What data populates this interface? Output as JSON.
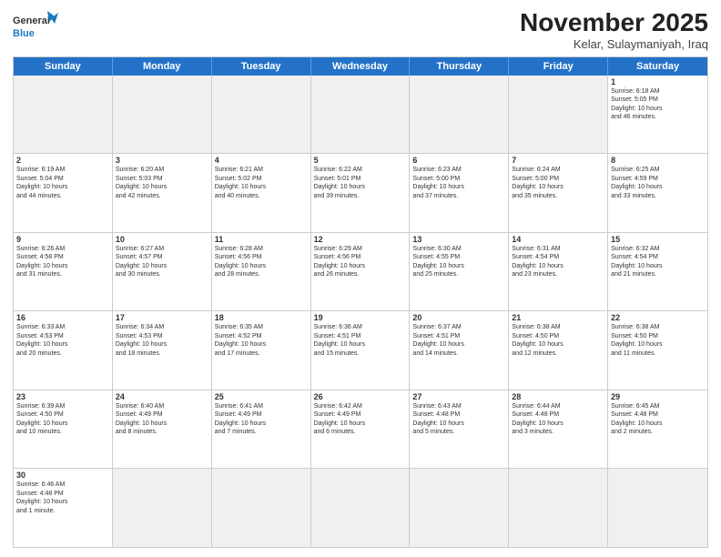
{
  "header": {
    "logo_general": "General",
    "logo_blue": "Blue",
    "month_title": "November 2025",
    "subtitle": "Kelar, Sulaymaniyah, Iraq"
  },
  "weekdays": [
    "Sunday",
    "Monday",
    "Tuesday",
    "Wednesday",
    "Thursday",
    "Friday",
    "Saturday"
  ],
  "weeks": [
    [
      {
        "day": "",
        "empty": true
      },
      {
        "day": "",
        "empty": true
      },
      {
        "day": "",
        "empty": true
      },
      {
        "day": "",
        "empty": true
      },
      {
        "day": "",
        "empty": true
      },
      {
        "day": "",
        "empty": true
      },
      {
        "day": "1",
        "info": "Sunrise: 6:18 AM\nSunset: 5:05 PM\nDaylight: 10 hours\nand 46 minutes."
      }
    ],
    [
      {
        "day": "2",
        "info": "Sunrise: 6:19 AM\nSunset: 5:04 PM\nDaylight: 10 hours\nand 44 minutes."
      },
      {
        "day": "3",
        "info": "Sunrise: 6:20 AM\nSunset: 5:03 PM\nDaylight: 10 hours\nand 42 minutes."
      },
      {
        "day": "4",
        "info": "Sunrise: 6:21 AM\nSunset: 5:02 PM\nDaylight: 10 hours\nand 40 minutes."
      },
      {
        "day": "5",
        "info": "Sunrise: 6:22 AM\nSunset: 5:01 PM\nDaylight: 10 hours\nand 39 minutes."
      },
      {
        "day": "6",
        "info": "Sunrise: 6:23 AM\nSunset: 5:00 PM\nDaylight: 10 hours\nand 37 minutes."
      },
      {
        "day": "7",
        "info": "Sunrise: 6:24 AM\nSunset: 5:00 PM\nDaylight: 10 hours\nand 35 minutes."
      },
      {
        "day": "8",
        "info": "Sunrise: 6:25 AM\nSunset: 4:59 PM\nDaylight: 10 hours\nand 33 minutes."
      }
    ],
    [
      {
        "day": "9",
        "info": "Sunrise: 6:26 AM\nSunset: 4:58 PM\nDaylight: 10 hours\nand 31 minutes."
      },
      {
        "day": "10",
        "info": "Sunrise: 6:27 AM\nSunset: 4:57 PM\nDaylight: 10 hours\nand 30 minutes."
      },
      {
        "day": "11",
        "info": "Sunrise: 6:28 AM\nSunset: 4:56 PM\nDaylight: 10 hours\nand 28 minutes."
      },
      {
        "day": "12",
        "info": "Sunrise: 6:29 AM\nSunset: 4:56 PM\nDaylight: 10 hours\nand 26 minutes."
      },
      {
        "day": "13",
        "info": "Sunrise: 6:30 AM\nSunset: 4:55 PM\nDaylight: 10 hours\nand 25 minutes."
      },
      {
        "day": "14",
        "info": "Sunrise: 6:31 AM\nSunset: 4:54 PM\nDaylight: 10 hours\nand 23 minutes."
      },
      {
        "day": "15",
        "info": "Sunrise: 6:32 AM\nSunset: 4:54 PM\nDaylight: 10 hours\nand 21 minutes."
      }
    ],
    [
      {
        "day": "16",
        "info": "Sunrise: 6:33 AM\nSunset: 4:53 PM\nDaylight: 10 hours\nand 20 minutes."
      },
      {
        "day": "17",
        "info": "Sunrise: 6:34 AM\nSunset: 4:53 PM\nDaylight: 10 hours\nand 18 minutes."
      },
      {
        "day": "18",
        "info": "Sunrise: 6:35 AM\nSunset: 4:52 PM\nDaylight: 10 hours\nand 17 minutes."
      },
      {
        "day": "19",
        "info": "Sunrise: 6:36 AM\nSunset: 4:51 PM\nDaylight: 10 hours\nand 15 minutes."
      },
      {
        "day": "20",
        "info": "Sunrise: 6:37 AM\nSunset: 4:51 PM\nDaylight: 10 hours\nand 14 minutes."
      },
      {
        "day": "21",
        "info": "Sunrise: 6:38 AM\nSunset: 4:50 PM\nDaylight: 10 hours\nand 12 minutes."
      },
      {
        "day": "22",
        "info": "Sunrise: 6:38 AM\nSunset: 4:50 PM\nDaylight: 10 hours\nand 11 minutes."
      }
    ],
    [
      {
        "day": "23",
        "info": "Sunrise: 6:39 AM\nSunset: 4:50 PM\nDaylight: 10 hours\nand 10 minutes."
      },
      {
        "day": "24",
        "info": "Sunrise: 6:40 AM\nSunset: 4:49 PM\nDaylight: 10 hours\nand 8 minutes."
      },
      {
        "day": "25",
        "info": "Sunrise: 6:41 AM\nSunset: 4:49 PM\nDaylight: 10 hours\nand 7 minutes."
      },
      {
        "day": "26",
        "info": "Sunrise: 6:42 AM\nSunset: 4:49 PM\nDaylight: 10 hours\nand 6 minutes."
      },
      {
        "day": "27",
        "info": "Sunrise: 6:43 AM\nSunset: 4:48 PM\nDaylight: 10 hours\nand 5 minutes."
      },
      {
        "day": "28",
        "info": "Sunrise: 6:44 AM\nSunset: 4:48 PM\nDaylight: 10 hours\nand 3 minutes."
      },
      {
        "day": "29",
        "info": "Sunrise: 6:45 AM\nSunset: 4:48 PM\nDaylight: 10 hours\nand 2 minutes."
      }
    ],
    [
      {
        "day": "30",
        "info": "Sunrise: 6:46 AM\nSunset: 4:48 PM\nDaylight: 10 hours\nand 1 minute."
      },
      {
        "day": "",
        "empty": true
      },
      {
        "day": "",
        "empty": true
      },
      {
        "day": "",
        "empty": true
      },
      {
        "day": "",
        "empty": true
      },
      {
        "day": "",
        "empty": true
      },
      {
        "day": "",
        "empty": true
      }
    ]
  ]
}
